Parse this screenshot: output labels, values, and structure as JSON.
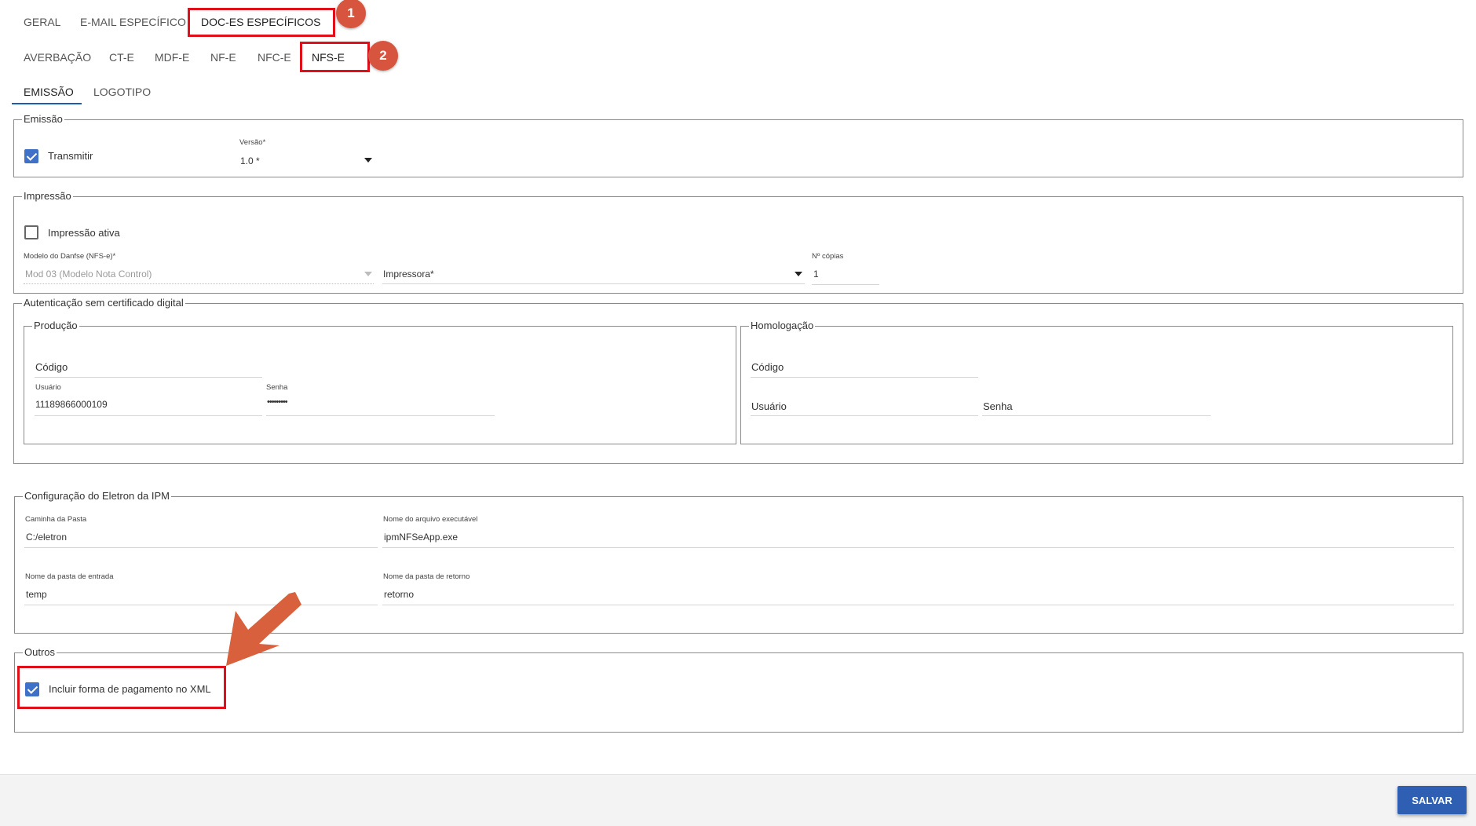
{
  "tabs_level1": [
    "GERAL",
    "E-MAIL ESPECÍFICO",
    "DOC-ES ESPECÍFICOS"
  ],
  "tabs_level2": [
    "AVERBAÇÃO",
    "CT-E",
    "MDF-E",
    "NF-E",
    "NFC-E",
    "NFS-E"
  ],
  "tabs_level3": [
    "EMISSÃO",
    "LOGOTIPO"
  ],
  "badges": [
    "1",
    "2"
  ],
  "emissao": {
    "legend": "Emissão",
    "transmitir_label": "Transmitir",
    "transmitir_checked": true,
    "versao_label": "Versão*",
    "versao_value": "1.0 *"
  },
  "impressao": {
    "legend": "Impressão",
    "ativa_label": "Impressão ativa",
    "ativa_checked": false,
    "modelo_label": "Modelo do Danfse (NFS-e)*",
    "modelo_value": "Mod 03 (Modelo Nota Control)",
    "impressora_placeholder": "Impressora*",
    "copias_label": "Nº cópias",
    "copias_value": "1"
  },
  "autenticacao": {
    "legend": "Autenticação sem certificado digital",
    "producao": {
      "legend": "Produção",
      "codigo_placeholder": "Código",
      "usuario_label": "Usuário",
      "usuario_value": "11189866000109",
      "senha_label": "Senha",
      "senha_value": "•••••••••"
    },
    "homologacao": {
      "legend": "Homologação",
      "codigo_placeholder": "Código",
      "usuario_placeholder": "Usuário",
      "senha_placeholder": "Senha"
    }
  },
  "eletron": {
    "legend": "Configuração do Eletron da IPM",
    "caminho_label": "Caminha da Pasta",
    "caminho_value": "C:/eletron",
    "executavel_label": "Nome do arquivo executável",
    "executavel_value": "ipmNFSeApp.exe",
    "entrada_label": "Nome da pasta de entrada",
    "entrada_value": "temp",
    "retorno_label": "Nome da pasta de retorno",
    "retorno_value": "retorno"
  },
  "outros": {
    "legend": "Outros",
    "incluir_label": "Incluir forma de pagamento no XML",
    "incluir_checked": true
  },
  "footer": {
    "save_label": "SALVAR",
    "save_color": "#2f5fb3"
  },
  "annotation_color": "#e0101b",
  "arrow_color": "#d9603c"
}
